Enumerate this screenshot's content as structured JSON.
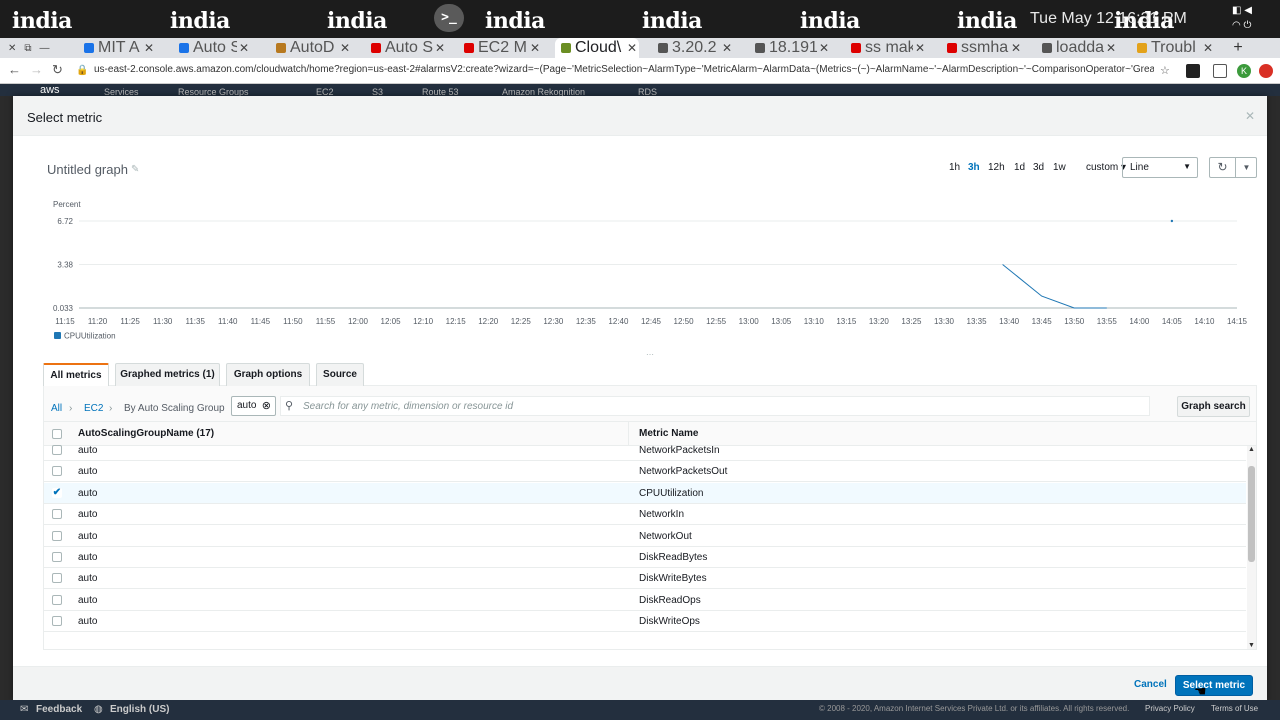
{
  "os": {
    "workspace_label": "india",
    "clock": "Tue May 12  16:31 PM",
    "terminal_label": ">_",
    "tray_icons": [
      "battery-icon",
      "volume-icon",
      "wifi-icon",
      "power-icon"
    ]
  },
  "browser": {
    "tabs": [
      {
        "label": "MIT A",
        "color": "#1a73e8"
      },
      {
        "label": "Auto S",
        "color": "#1a73e8"
      },
      {
        "label": "AutoD",
        "color": "#b7791f"
      },
      {
        "label": "Auto S",
        "color": "#d00"
      },
      {
        "label": "EC2 M",
        "color": "#d00"
      },
      {
        "label": "Cloud\\",
        "color": "#6b8e23",
        "active": true
      },
      {
        "label": "3.20.2",
        "color": "#555"
      },
      {
        "label": "18.191",
        "color": "#555"
      },
      {
        "label": "ss mak",
        "color": "#d00"
      },
      {
        "label": "ssmha",
        "color": "#d00"
      },
      {
        "label": "loadda",
        "color": "#555"
      },
      {
        "label": "Troubl",
        "color": "#e3a21a"
      }
    ],
    "url": "us-east-2.console.aws.amazon.com/cloudwatch/home?region=us-east-2#alarmsV2:create?wizard=~(Page~'MetricSelection~AlarmType~'MetricAlarm~AlarmData~(Metrics~(~)~AlarmName~'~AlarmDescription~'~ComparisonOperator~'GreaterThanTh...",
    "extension_initial": "K"
  },
  "console": {
    "aws_label": "aws",
    "nav_items": [
      "Services",
      "Resource Groups",
      "EC2",
      "S3",
      "Route 53",
      "Amazon Rekognition",
      "RDS"
    ],
    "footer": {
      "feedback": "Feedback",
      "language": "English (US)",
      "copyright": "© 2008 - 2020, Amazon Internet Services Private Ltd. or its affiliates. All rights reserved.",
      "privacy": "Privacy Policy",
      "terms": "Terms of Use"
    }
  },
  "modal": {
    "title": "Select metric",
    "graph_title": "Untitled graph",
    "time_ranges": [
      "1h",
      "3h",
      "12h",
      "1d",
      "3d",
      "1w"
    ],
    "selected_range": "3h",
    "custom_label": "custom",
    "graph_type": "Line",
    "sub_tabs": [
      "All metrics",
      "Graphed metrics (1)",
      "Graph options",
      "Source"
    ],
    "active_sub_tab": "All metrics",
    "breadcrumb": [
      "All",
      "EC2",
      "By Auto Scaling Group"
    ],
    "filter_chip": "auto",
    "search_placeholder": "Search for any metric, dimension or resource id",
    "graph_search_label": "Graph search",
    "table": {
      "columns": [
        "AutoScalingGroupName (17)",
        "Metric Name"
      ],
      "rows": [
        {
          "group": "auto",
          "metric": "NetworkPacketsIn",
          "checked": false
        },
        {
          "group": "auto",
          "metric": "NetworkPacketsOut",
          "checked": false
        },
        {
          "group": "auto",
          "metric": "CPUUtilization",
          "checked": true
        },
        {
          "group": "auto",
          "metric": "NetworkIn",
          "checked": false
        },
        {
          "group": "auto",
          "metric": "NetworkOut",
          "checked": false
        },
        {
          "group": "auto",
          "metric": "DiskReadBytes",
          "checked": false
        },
        {
          "group": "auto",
          "metric": "DiskWriteBytes",
          "checked": false
        },
        {
          "group": "auto",
          "metric": "DiskReadOps",
          "checked": false
        },
        {
          "group": "auto",
          "metric": "DiskWriteOps",
          "checked": false
        }
      ]
    },
    "cancel_label": "Cancel",
    "select_label": "Select metric"
  },
  "chart_data": {
    "type": "line",
    "ylabel": "Percent",
    "y_ticks": [
      "6.72",
      "3.38",
      "0.033"
    ],
    "ylim": [
      0.033,
      6.72
    ],
    "x_ticks": [
      "11:15",
      "11:20",
      "11:25",
      "11:30",
      "11:35",
      "11:40",
      "11:45",
      "11:50",
      "11:55",
      "12:00",
      "12:05",
      "12:10",
      "12:15",
      "12:20",
      "12:25",
      "12:30",
      "12:35",
      "12:40",
      "12:45",
      "12:50",
      "12:55",
      "13:00",
      "13:05",
      "13:10",
      "13:15",
      "13:20",
      "13:25",
      "13:30",
      "13:35",
      "13:40",
      "13:45",
      "13:50",
      "13:55",
      "14:00",
      "14:05",
      "14:10",
      "14:15"
    ],
    "series": [
      {
        "name": "CPUUtilization",
        "color": "#1f77b4",
        "points": [
          {
            "x": "13:39",
            "y": 3.38
          },
          {
            "x": "13:45",
            "y": 0.95
          },
          {
            "x": "13:50",
            "y": 0.033
          },
          {
            "x": "13:55",
            "y": 0.033
          },
          {
            "x": "14:05",
            "y": 6.72
          }
        ]
      }
    ],
    "grid": true,
    "legend_position": "bottom-left"
  }
}
